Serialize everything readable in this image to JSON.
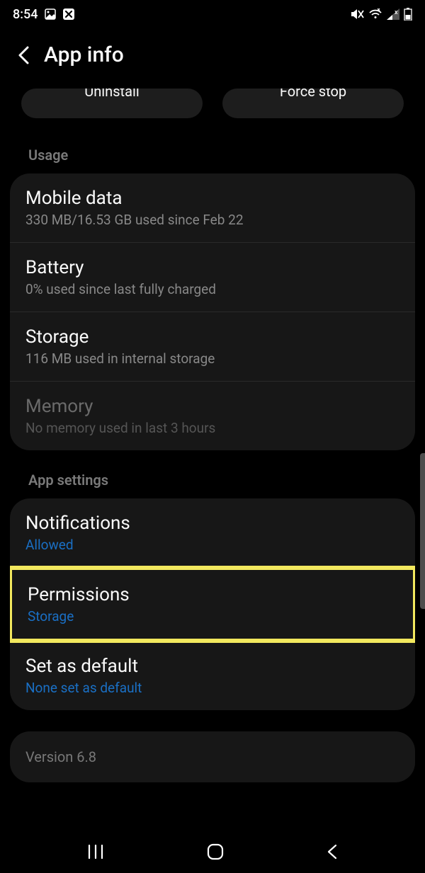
{
  "statusbar": {
    "time": "8:54"
  },
  "header": {
    "title": "App info"
  },
  "actions": {
    "uninstall": "Uninstall",
    "force_stop": "Force stop"
  },
  "usage": {
    "section_label": "Usage",
    "mobile_data": {
      "title": "Mobile data",
      "sub": "330 MB/16.53 GB used since Feb 22"
    },
    "battery": {
      "title": "Battery",
      "sub": "0% used since last fully charged"
    },
    "storage": {
      "title": "Storage",
      "sub": "116 MB used in internal storage"
    },
    "memory": {
      "title": "Memory",
      "sub": "No memory used in last 3 hours"
    }
  },
  "app_settings": {
    "section_label": "App settings",
    "notifications": {
      "title": "Notifications",
      "sub": "Allowed"
    },
    "permissions": {
      "title": "Permissions",
      "sub": "Storage"
    },
    "set_default": {
      "title": "Set as default",
      "sub": "None set as default"
    }
  },
  "version": {
    "text": "Version 6.8"
  }
}
